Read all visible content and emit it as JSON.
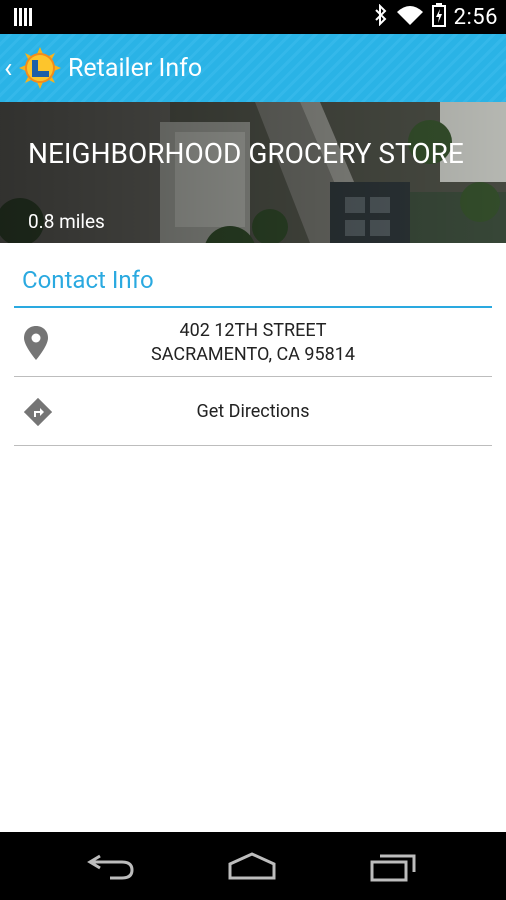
{
  "status_bar": {
    "time": "2:56"
  },
  "action_bar": {
    "title": "Retailer Info"
  },
  "store": {
    "name": "NEIGHBORHOOD GROCERY STORE",
    "distance": "0.8 miles"
  },
  "contact": {
    "header": "Contact Info",
    "address_line1": "402 12TH STREET",
    "address_line2": "SACRAMENTO, CA 95814",
    "directions_label": "Get Directions"
  },
  "colors": {
    "accent": "#2aa9e0",
    "action_bar": "#33b5e5"
  }
}
